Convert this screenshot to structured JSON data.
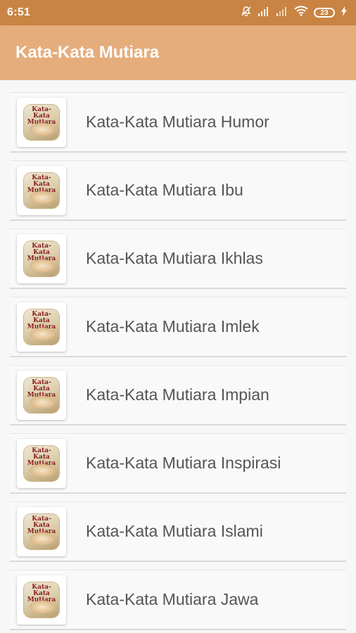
{
  "status_bar": {
    "time": "6:51",
    "battery": "23",
    "icons": [
      "mute-icon",
      "signal-icon",
      "signal-weak-icon",
      "wifi-icon",
      "battery-icon",
      "charging-icon"
    ]
  },
  "app_bar": {
    "title": "Kata-Kata Mutiara"
  },
  "list": {
    "items": [
      {
        "label": "Kata-Kata Mutiara Humor",
        "icon_text": "Kata-Kata Mutiara"
      },
      {
        "label": "Kata-Kata Mutiara Ibu",
        "icon_text": "Kata-Kata Mutiara"
      },
      {
        "label": "Kata-Kata Mutiara Ikhlas",
        "icon_text": "Kata-Kata Mutiara"
      },
      {
        "label": "Kata-Kata Mutiara Imlek",
        "icon_text": "Kata-Kata Mutiara"
      },
      {
        "label": "Kata-Kata Mutiara Impian",
        "icon_text": "Kata-Kata Mutiara"
      },
      {
        "label": "Kata-Kata Mutiara Inspirasi",
        "icon_text": "Kata-Kata Mutiara"
      },
      {
        "label": "Kata-Kata Mutiara Islami",
        "icon_text": "Kata-Kata Mutiara"
      },
      {
        "label": "Kata-Kata Mutiara Jawa",
        "icon_text": "Kata-Kata Mutiara"
      }
    ]
  },
  "colors": {
    "status_bar": "#c98443",
    "app_bar": "#e5ad7c",
    "text": "#555555"
  }
}
